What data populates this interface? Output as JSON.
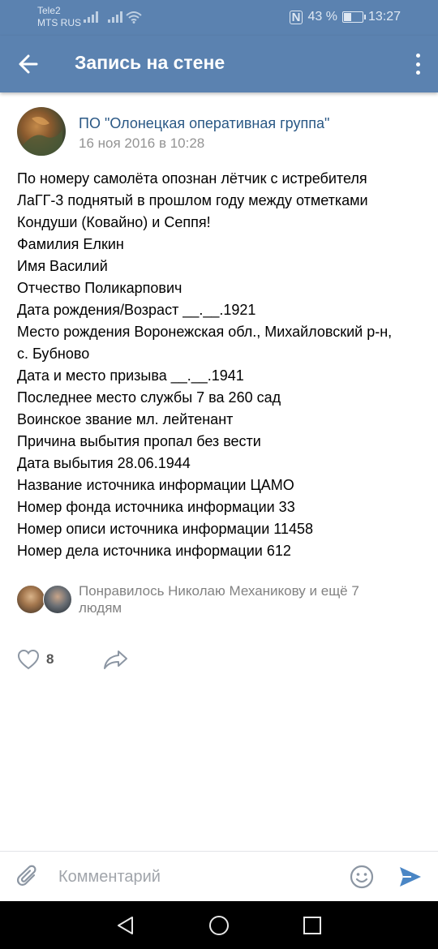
{
  "status_bar": {
    "carrier_1": "Tele2",
    "carrier_2": "MTS RUS",
    "battery_text": "43 %",
    "battery_level_percent": 43,
    "time": "13:27",
    "icons": [
      "signal-icon",
      "wifi-icon",
      "nfc-icon",
      "battery-icon"
    ]
  },
  "app_bar": {
    "title": "Запись на стене",
    "back_icon": "arrow-left-icon",
    "menu_icon": "more-vertical-icon",
    "background_color": "#5b82b0"
  },
  "post": {
    "author": "ПО \"Олонецкая оперативная группа\"",
    "date": "16 ноя 2016 в 10:28",
    "lines": [
      "По номеру самолёта опознан лётчик с истребителя",
      "ЛаГГ-3 поднятый в прошлом году между отметками",
      "Кондуши (Ковайно) и Сеппя!",
      "Фамилия Елкин",
      "Имя Василий",
      "Отчество Поликарпович",
      "Дата рождения/Возраст __.__.1921",
      "Место рождения Воронежская обл., Михайловский р-н,",
      "с. Бубново",
      "Дата и место призыва __.__.1941",
      "Последнее место службы 7 ва 260 сад",
      "Воинское звание мл. лейтенант",
      "Причина выбытия пропал без вести",
      "Дата выбытия 28.06.1944",
      "Название источника информации ЦАМО",
      "Номер фонда источника информации 33",
      "Номер описи источника информации 11458",
      "Номер дела источника информации 612"
    ],
    "likes_text": "Понравилось Николаю Механикову и ещё 7 людям",
    "like_count": "8",
    "link_color": "#2a5885"
  },
  "comment_bar": {
    "placeholder": "Комментарий",
    "icons": [
      "paperclip-icon",
      "emoji-icon",
      "send-icon"
    ],
    "send_color": "#4a86c5"
  },
  "nav_bar": {
    "icons": [
      "nav-back-icon",
      "nav-home-icon",
      "nav-recent-icon"
    ]
  }
}
